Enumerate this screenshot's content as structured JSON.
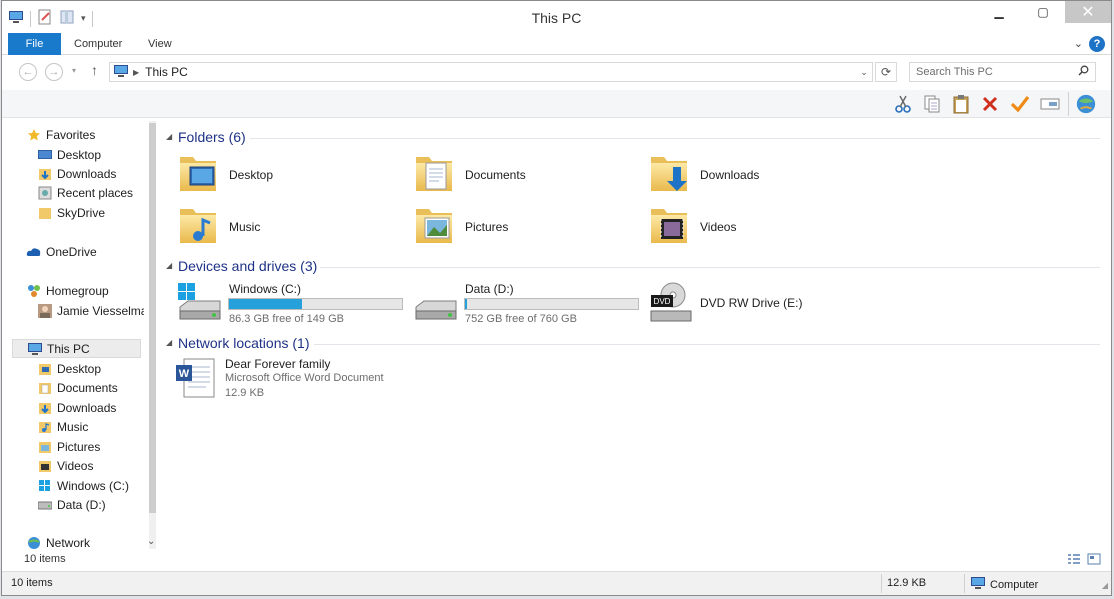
{
  "window": {
    "title": "This PC"
  },
  "ribbon": {
    "tabs": [
      "File",
      "Computer",
      "View"
    ]
  },
  "address": {
    "crumb": "This PC",
    "search_placeholder": "Search This PC"
  },
  "toolbar": {
    "icons": [
      "cut-icon",
      "copy-icon",
      "paste-icon",
      "delete-icon",
      "checkmark-icon",
      "rename-icon",
      "globe-icon"
    ]
  },
  "nav": {
    "favorites": {
      "label": "Favorites",
      "items": [
        "Desktop",
        "Downloads",
        "Recent places",
        "SkyDrive"
      ]
    },
    "onedrive": "OneDrive",
    "homegroup": {
      "label": "Homegroup",
      "items": [
        "Jamie Viesselman"
      ]
    },
    "thispc": {
      "label": "This PC",
      "items": [
        "Desktop",
        "Documents",
        "Downloads",
        "Music",
        "Pictures",
        "Videos",
        "Windows (C:)",
        "Data (D:)"
      ]
    },
    "network": "Network",
    "count": "10 items"
  },
  "content": {
    "folders_title": "Folders (6)",
    "folders": [
      "Desktop",
      "Documents",
      "Downloads",
      "Music",
      "Pictures",
      "Videos"
    ],
    "devices_title": "Devices and drives (3)",
    "drives": [
      {
        "name": "Windows (C:)",
        "free": "86.3 GB free of 149 GB",
        "used_fraction": 0.42
      },
      {
        "name": "Data (D:)",
        "free": "752 GB free of 760 GB",
        "used_fraction": 0.01
      },
      {
        "name": "DVD RW Drive (E:)"
      }
    ],
    "network_title": "Network locations (1)",
    "network_item": {
      "name": "Dear Forever family",
      "type": "Microsoft Office Word Document",
      "size": "12.9 KB"
    }
  },
  "status": {
    "items": "10 items",
    "size": "12.9 KB",
    "location": "Computer"
  },
  "colors": {
    "accent": "#1979ca",
    "header": "#1e3287",
    "drive_fill": "#26a0da",
    "folder": "#f1c968"
  }
}
